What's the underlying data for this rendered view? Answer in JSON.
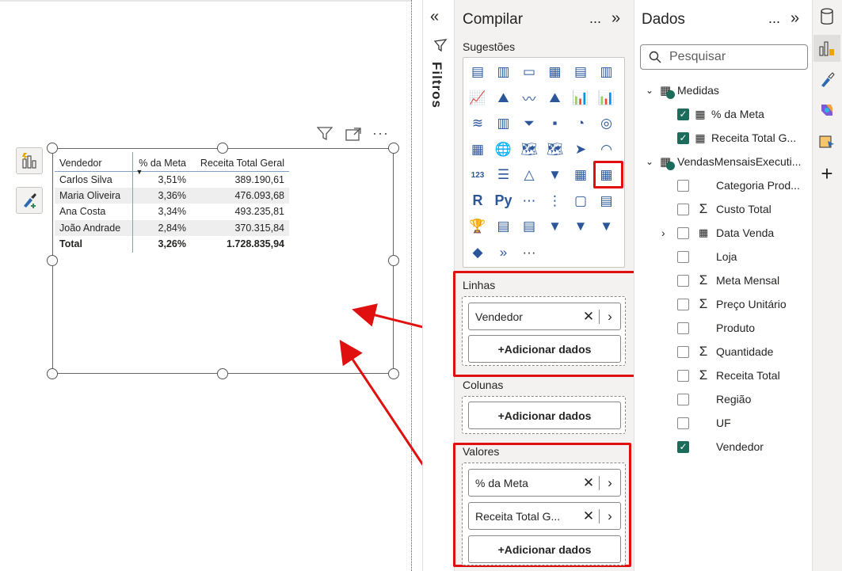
{
  "table": {
    "headers": [
      "Vendedor",
      "% da Meta",
      "Receita Total Geral"
    ],
    "rows": [
      [
        "Carlos Silva",
        "3,51%",
        "389.190,61"
      ],
      [
        "Maria Oliveira",
        "3,36%",
        "476.093,68"
      ],
      [
        "Ana Costa",
        "3,34%",
        "493.235,81"
      ],
      [
        "João Andrade",
        "2,84%",
        "370.315,84"
      ]
    ],
    "total": [
      "Total",
      "3,26%",
      "1.728.835,94"
    ],
    "sort_indicator": "▼"
  },
  "filters": {
    "label": "Filtros"
  },
  "build": {
    "title": "Compilar",
    "suggestions_label": "Sugestões",
    "rows_label": "Linhas",
    "columns_label": "Colunas",
    "values_label": "Valores",
    "rows_field": "Vendedor",
    "values_fields": [
      "% da Meta",
      "Receita Total G..."
    ],
    "add_label": "+Adicionar dados",
    "more": "...",
    "viz_icons": [
      "▤",
      "▥",
      "▭",
      "▦",
      "▤",
      "▥",
      "📈",
      "⛰",
      "〰",
      "⛰",
      "📊",
      "📊",
      "≋",
      "▥",
      "⏷",
      "▪",
      "◔",
      "◎",
      "▦",
      "🌐",
      "🗺",
      "🗺",
      "➤",
      "◠",
      "123",
      "☰",
      "△",
      "▼",
      "▦",
      "▦",
      "R",
      "Py",
      "⋯",
      "⋮",
      "▢",
      "▤",
      "🏆",
      "▤",
      "▤",
      "▼",
      "▼",
      "▼",
      "◆",
      "»",
      "···"
    ]
  },
  "data": {
    "title": "Dados",
    "search_placeholder": "Pesquisar",
    "measures_group": "Medidas",
    "measures": [
      {
        "label": "% da Meta",
        "checked": true
      },
      {
        "label": "Receita Total G...",
        "checked": true
      }
    ],
    "table_group": "VendasMensaisExecuti...",
    "fields": [
      {
        "label": "Categoria Prod...",
        "sigma": false,
        "checked": false
      },
      {
        "label": "Custo Total",
        "sigma": true,
        "checked": false
      },
      {
        "label": "Data Venda",
        "sigma": false,
        "checked": false,
        "calendar": true
      },
      {
        "label": "Loja",
        "sigma": false,
        "checked": false
      },
      {
        "label": "Meta Mensal",
        "sigma": true,
        "checked": false
      },
      {
        "label": "Preço Unitário",
        "sigma": true,
        "checked": false
      },
      {
        "label": "Produto",
        "sigma": false,
        "checked": false
      },
      {
        "label": "Quantidade",
        "sigma": true,
        "checked": false
      },
      {
        "label": "Receita Total",
        "sigma": true,
        "checked": false
      },
      {
        "label": "Região",
        "sigma": false,
        "checked": false
      },
      {
        "label": "UF",
        "sigma": false,
        "checked": false
      },
      {
        "label": "Vendedor",
        "sigma": false,
        "checked": true
      }
    ]
  },
  "colors": {
    "accent_red": "#e01010",
    "check_green": "#1d6b5a",
    "header_line": "#7ea1c4"
  }
}
